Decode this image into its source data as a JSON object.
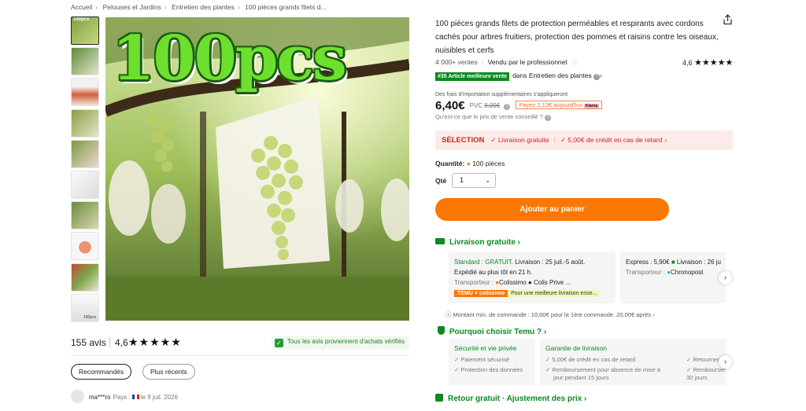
{
  "breadcrumb": [
    "Accueil",
    "Pelouses et Jardins",
    "Entretien des plantes",
    "100 pièces grands filets d..."
  ],
  "gallery": {
    "hero_text": "100pcs",
    "thumb_first_label": "100pcs",
    "thumb_last_label": "100pcs"
  },
  "reviews": {
    "count": "155 avis",
    "rating": "4,6",
    "stars": "★★★★★",
    "verified": "Tous les avis proviennent d'achats vérifiés",
    "filter_recommended": "Recommandés",
    "filter_recent": "Plus récents",
    "reviewer_name": "ma***ro",
    "reviewer_country_label": "Pays :",
    "reviewer_date": "le 9 juil. 2026"
  },
  "product": {
    "title": "100 pièces grands filets de protection perméables et respirants avec cordons cachés pour arbres fruitiers, protection des pommes et raisins contre les oiseaux, nuisibles et cerfs",
    "sales": "4 000+ ventes",
    "sold_by": "Vendu par le professionnel",
    "rating": "4,6",
    "rating_stars": "★★★★★",
    "best_tag": "#35 Article meilleure vente",
    "best_category": "dans Entretien des plantes",
    "import_note": "Des frais d'importation supplémentaires s'appliqueront",
    "price": "6,40€",
    "pvc_label": "PVC",
    "pvc_price": "8,09€",
    "klarna": "Payez 2,13€ aujourd'hui",
    "klarna_badge": "Klarna",
    "conseil": "Qu'est-ce que le prix de vente conseillé ?"
  },
  "promo": {
    "label": "SÉLECTION",
    "free_shipping": "✓ Livraison gratuite",
    "credit": "✓ 5,00€ de crédit en cas de retard"
  },
  "quantity": {
    "label": "Quantité:",
    "value": "100 pièces",
    "qte_label": "Qté",
    "qte_value": "1"
  },
  "cart_button": "Ajouter au panier",
  "shipping": {
    "heading": "Livraison gratuite",
    "standard_label": "Standard : GRATUIT.",
    "standard_delivery": "Livraison : 25 juil.-5 août.",
    "standard_dispatch": "Expédié au plus tôt en 21 h.",
    "carrier_label": "Transporteur :",
    "carrier_value": "Colissimo ● Colis Prive ...",
    "temu_tag": "TEMU × colissimo",
    "temu_tag_text": "Pour une meilleure livraison ense...",
    "express_label": "Express : 5,90€",
    "express_delivery": "Livraison : 26 ju",
    "express_carrier_label": "Transporteur :",
    "express_carrier": "Chronopost",
    "min_order": "Montant min. de commande : 10,00€ pour la 1ère commande. 20,00€ après"
  },
  "why": {
    "heading": "Pourquoi choisir Temu ?",
    "security_title": "Sécurité et vie privée",
    "security_items": [
      "✓ Paiement sécurisé",
      "✓ Protection des données"
    ],
    "guarantee_title": "Garantie de livraison",
    "guarantee_items": [
      "✓ 5,00€ de crédit en cas de retard",
      "✓ Remboursement pour absence de mise à",
      "jour pendant 15 jours"
    ],
    "guarantee_right": [
      "✓ Retourner",
      "✓ Rembourser",
      "30 jours"
    ]
  },
  "retour": "Retour gratuit · Ajustement des prix",
  "colors": {
    "accent": "#fb7701",
    "green": "#0a8a1f",
    "red": "#d0211e"
  }
}
